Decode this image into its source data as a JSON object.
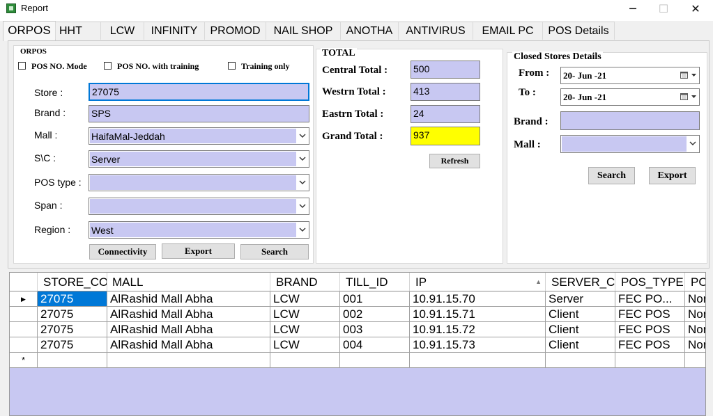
{
  "window": {
    "title": "Report",
    "minimize_glyph": "─",
    "maximize_glyph": "☐",
    "close_glyph": "✕"
  },
  "tabs": [
    {
      "label": "ORPOS"
    },
    {
      "label": "HHT"
    },
    {
      "label": "LCW"
    },
    {
      "label": "INFINITY"
    },
    {
      "label": "PROMOD"
    },
    {
      "label": "NAIL SHOP"
    },
    {
      "label": "ANOTHA"
    },
    {
      "label": "ANTIVIRUS"
    },
    {
      "label": "EMAIL PC"
    },
    {
      "label": "POS Details"
    }
  ],
  "orpos": {
    "legend": "ORPOS",
    "checks": [
      {
        "label": "POS NO. Mode",
        "checked": false
      },
      {
        "label": "POS NO. with training",
        "checked": false
      },
      {
        "label": "Training only",
        "checked": false
      }
    ],
    "store_label": "Store :",
    "store_value": "27075",
    "brand_label": "Brand :",
    "brand_value": "SPS",
    "mall_label": "Mall :",
    "mall_value": "HaifaMal-Jeddah",
    "sc_label": "S\\C :",
    "sc_value": "Server",
    "postype_label": "POS type :",
    "postype_value": "",
    "span_label": "Span :",
    "span_value": "",
    "region_label": "Region :",
    "region_value": "West",
    "connectivity_button": "Connectivity",
    "export_button": "Export",
    "search_button": "Search"
  },
  "total": {
    "legend": "TOTAL",
    "central_label": "Central Total :",
    "central_value": "500",
    "western_label": "Westrn Total :",
    "western_value": "413",
    "eastern_label": "Eastrn Total :",
    "eastern_value": "24",
    "grand_label": "Grand Total :",
    "grand_value": "937",
    "refresh_button": "Refresh",
    "grand_color": "#ffff00"
  },
  "closed": {
    "legend": "Closed Stores Details",
    "from_label": "From :",
    "from_value": "20- Jun -21",
    "to_label": "To :",
    "to_value": "20- Jun -21",
    "brand_label": "Brand :",
    "brand_value": "",
    "mall_label": "Mall :",
    "mall_value": "",
    "search_button": "Search",
    "export_button": "Export"
  },
  "grid": {
    "columns": [
      "STORE_CODE",
      "MALL",
      "BRAND",
      "TILL_ID",
      "IP",
      "SERVER_CLIENT",
      "POS_TYPE",
      "POS"
    ],
    "column_display": [
      "STORE_CO",
      "MALL",
      "BRAND",
      "TILL_ID",
      "IP",
      "SERVER_C",
      "POS_TYPE",
      "PO"
    ],
    "sort_glyph": "▲",
    "current_row_glyph": "▶",
    "new_row_glyph": "*",
    "rows": [
      [
        "27075",
        "AlRashid Mall Abha",
        "LCW",
        "001",
        "10.91.15.70",
        "Server",
        "FEC PO...",
        "Nor"
      ],
      [
        "27075",
        "AlRashid Mall Abha",
        "LCW",
        "002",
        "10.91.15.71",
        "Client",
        "FEC POS",
        "Nor"
      ],
      [
        "27075",
        "AlRashid Mall Abha",
        "LCW",
        "003",
        "10.91.15.72",
        "Client",
        "FEC POS",
        "Nor"
      ],
      [
        "27075",
        "AlRashid Mall Abha",
        "LCW",
        "004",
        "10.91.15.73",
        "Client",
        "FEC POS",
        "Nor"
      ]
    ]
  },
  "colors": {
    "field_fill": "#c8c8f2",
    "selection": "#0078d7"
  }
}
